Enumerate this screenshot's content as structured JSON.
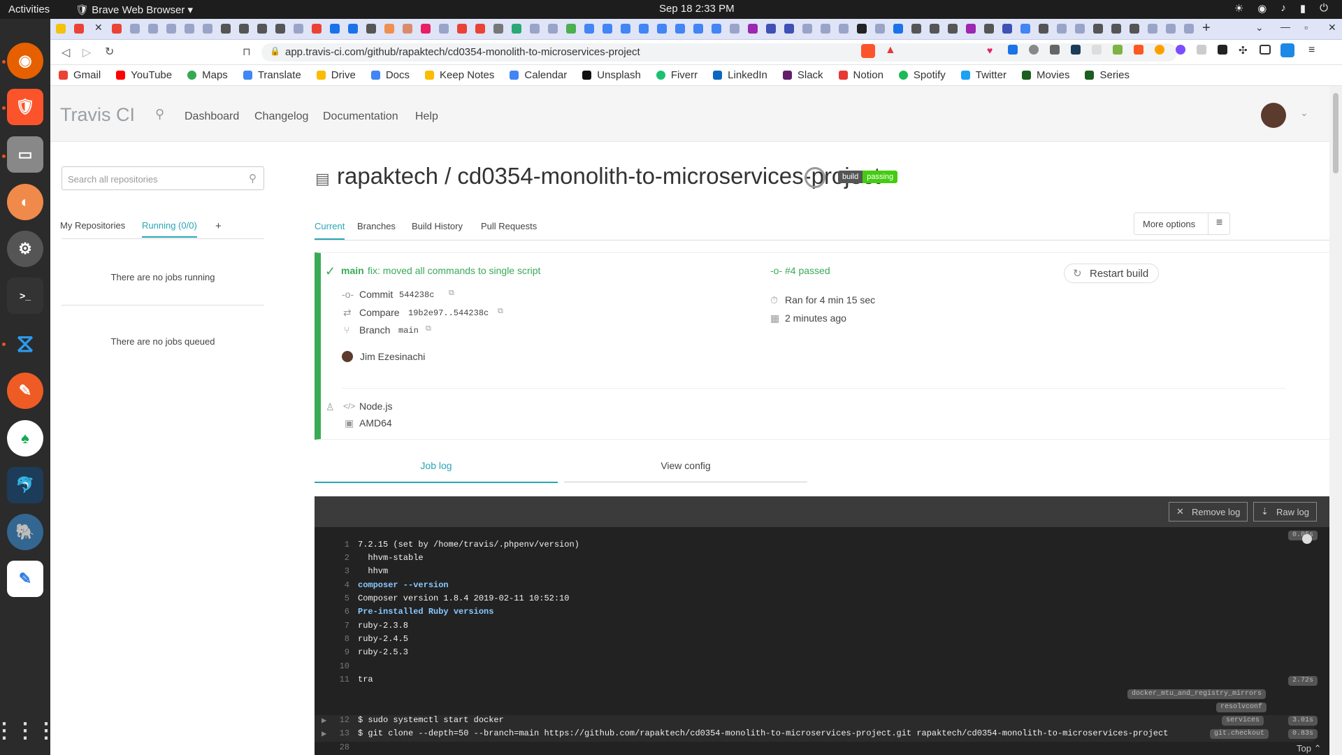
{
  "system": {
    "activities": "Activities",
    "app_name": "Brave Web Browser",
    "clock": "Sep 18  2:33 PM"
  },
  "browser": {
    "url": "app.travis-ci.com/github/rapaktech/cd0354-monolith-to-microservices-project"
  },
  "bookmarks": [
    "Gmail",
    "YouTube",
    "Maps",
    "Translate",
    "Drive",
    "Docs",
    "Keep Notes",
    "Calendar",
    "Unsplash",
    "Fiverr",
    "LinkedIn",
    "Slack",
    "Notion",
    "Spotify",
    "Twitter",
    "Movies",
    "Series"
  ],
  "header": {
    "logo": "Travis CI",
    "nav": [
      "Dashboard",
      "Changelog",
      "Documentation",
      "Help"
    ]
  },
  "sidebar": {
    "search_placeholder": "Search all repositories",
    "tab_my": "My Repositories",
    "tab_running": "Running (0/0)",
    "tab_add": "+",
    "no_jobs_running": "There are no jobs running",
    "no_jobs_queued": "There are no jobs queued"
  },
  "repo": {
    "title": "rapaktech / cd0354-monolith-to-microservices-project",
    "badge_left": "build",
    "badge_right": "passing",
    "tabs": [
      "Current",
      "Branches",
      "Build History",
      "Pull Requests"
    ],
    "more_options": "More options"
  },
  "build": {
    "branch": "main",
    "message": "fix: moved all commands to single script",
    "number": "#4 passed",
    "commit_label": "Commit",
    "commit": "544238c",
    "compare_label": "Compare",
    "compare": "19b2e97..544238c",
    "branch_label": "Branch",
    "branch_value": "main",
    "author": "Jim Ezesinachi",
    "duration": "Ran for 4 min 15 sec",
    "finished": "2 minutes ago",
    "restart": "Restart build",
    "language": "Node.js",
    "arch": "AMD64"
  },
  "log": {
    "tab_job": "Job log",
    "tab_config": "View config",
    "remove": "Remove log",
    "raw": "Raw log",
    "lines": [
      {
        "n": "1",
        "text": "7.2.15 (set by /home/travis/.phpenv/version)",
        "hl": false
      },
      {
        "n": "2",
        "text": "  hhvm-stable",
        "hl": false
      },
      {
        "n": "3",
        "text": "  hhvm",
        "hl": false
      },
      {
        "n": "4",
        "text": "composer --version",
        "hl": true
      },
      {
        "n": "5",
        "text": "Composer version 1.8.4 2019-02-11 10:52:10",
        "hl": false
      },
      {
        "n": "6",
        "text": "Pre-installed Ruby versions",
        "hl": true
      },
      {
        "n": "7",
        "text": "ruby-2.3.8",
        "hl": false
      },
      {
        "n": "8",
        "text": "ruby-2.4.5",
        "hl": false
      },
      {
        "n": "9",
        "text": "ruby-2.5.3",
        "hl": false
      },
      {
        "n": "10",
        "text": "",
        "hl": false
      },
      {
        "n": "11",
        "text": "tra",
        "hl": false
      },
      {
        "n": "12",
        "text": "$ sudo systemctl start docker",
        "hl": false
      },
      {
        "n": "13",
        "text": "$ git clone --depth=50 --branch=main https://github.com/rapaktech/cd0354-monolith-to-microservices-project.git rapaktech/cd0354-monolith-to-microservices-project",
        "hl": false
      },
      {
        "n": "28",
        "text": "",
        "hl": false
      }
    ],
    "tags": {
      "t1": "0.05s",
      "t2": "2.72s",
      "docker": "docker_mtu_and_registry_mirrors",
      "resolv": "resolvconf",
      "services": "services",
      "t3": "3.01s",
      "checkout": "git.checkout",
      "t4": "0.83s"
    },
    "top": "Top"
  }
}
